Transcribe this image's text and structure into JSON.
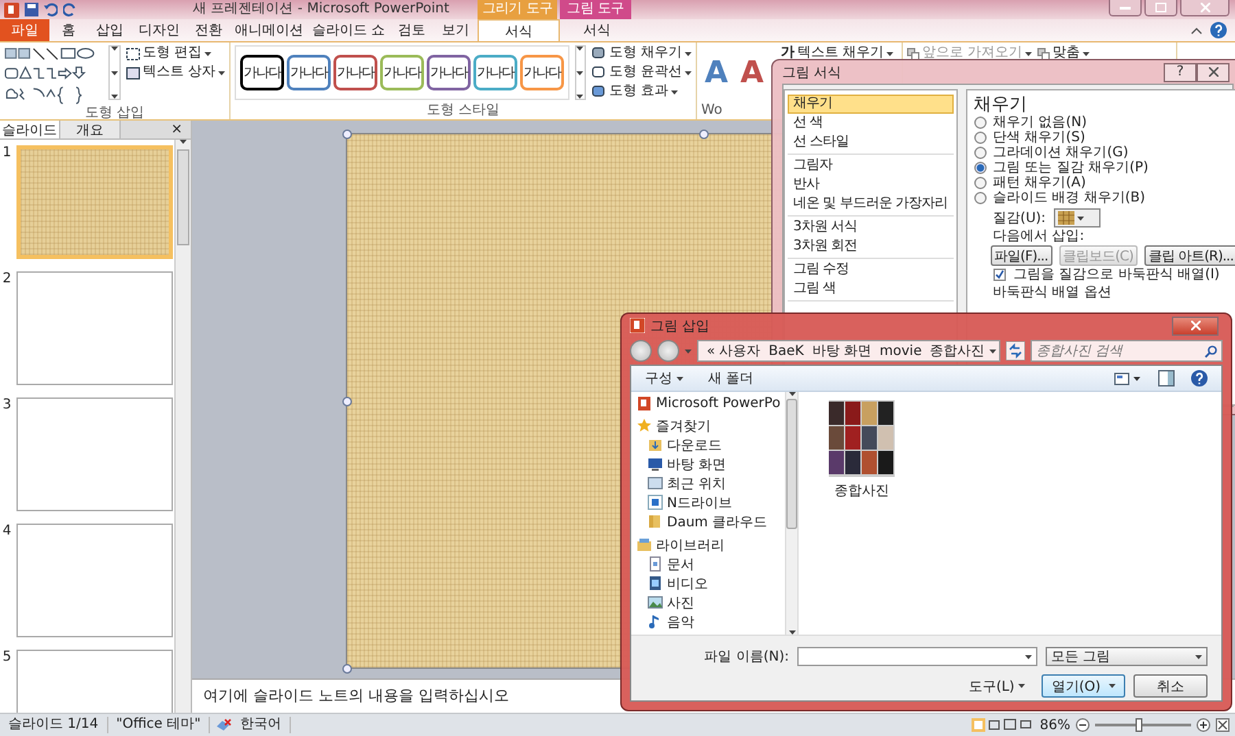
{
  "window": {
    "title": "새 프레젠테이션 - Microsoft PowerPoint",
    "context_tabs": [
      {
        "label": "그리기 도구",
        "color": "#e8a040"
      },
      {
        "label": "그림 도구",
        "color": "#d04a8a"
      }
    ]
  },
  "ribbon_tabs": [
    {
      "label": "파일",
      "kind": "file",
      "selected": false
    },
    {
      "label": "홈",
      "kind": "normal",
      "selected": false
    },
    {
      "label": "삽입",
      "kind": "normal",
      "selected": false
    },
    {
      "label": "디자인",
      "kind": "normal",
      "selected": false
    },
    {
      "label": "전환",
      "kind": "normal",
      "selected": false
    },
    {
      "label": "애니메이션",
      "kind": "normal",
      "selected": false
    },
    {
      "label": "슬라이드 쇼",
      "kind": "normal",
      "selected": false
    },
    {
      "label": "검토",
      "kind": "normal",
      "selected": false
    },
    {
      "label": "보기",
      "kind": "normal",
      "selected": false
    },
    {
      "label": "서식",
      "kind": "context",
      "selected": true
    },
    {
      "label": "서식",
      "kind": "context",
      "selected": false
    }
  ],
  "shape_insert": {
    "label": "도형 삽입",
    "commands": [
      "도형 편집",
      "텍스트 상자"
    ]
  },
  "shape_styles": {
    "label": "도형 스타일",
    "presets": [
      {
        "text": "가나다",
        "color": "#000000"
      },
      {
        "text": "가나다",
        "color": "#4f81bd"
      },
      {
        "text": "가나다",
        "color": "#c0504d"
      },
      {
        "text": "가나다",
        "color": "#9bbb59"
      },
      {
        "text": "가나다",
        "color": "#8064a2"
      },
      {
        "text": "가나다",
        "color": "#4bacc6"
      },
      {
        "text": "가나다",
        "color": "#f79646"
      }
    ],
    "commands": [
      "도형 채우기",
      "도형 윤곽선",
      "도형 효과"
    ]
  },
  "wordart": {
    "label": "Wo",
    "samples": [
      {
        "text": "A",
        "color": "#4f81bd"
      },
      {
        "text": "A",
        "color": "#c0504d"
      }
    ],
    "glyph": "가",
    "command": "텍스트 채우기"
  },
  "arrange": {
    "commands": [
      {
        "text": "앞으로 가져오기",
        "disabled": true
      },
      {
        "text": "맞춤",
        "disabled": false
      }
    ]
  },
  "slides_pane": {
    "tabs": [
      {
        "label": "슬라이드",
        "selected": true
      },
      {
        "label": "개요",
        "selected": false
      }
    ],
    "close": "×",
    "slides": [
      {
        "number": "1",
        "kind": "texture",
        "selected": true
      },
      {
        "number": "2",
        "kind": "blank",
        "selected": false
      },
      {
        "number": "3",
        "kind": "blank",
        "selected": false
      },
      {
        "number": "4",
        "kind": "blank",
        "selected": false
      },
      {
        "number": "5",
        "kind": "blank",
        "selected": false
      }
    ]
  },
  "slide": {
    "kind": "texture"
  },
  "notes": "여기에 슬라이드 노트의 내용을 입력하십시오",
  "status_bar": {
    "items": [
      "슬라이드 1/14",
      "\"Office 테마\"",
      "한국어"
    ],
    "zoom": "86%",
    "zoom_level": {
      "level": 0.45
    }
  },
  "format_dialog": {
    "title": "그림 서식",
    "help": "?",
    "categories": [
      [
        {
          "label": "채우기",
          "selected": true
        },
        {
          "label": "선 색",
          "selected": false
        },
        {
          "label": "선 스타일",
          "selected": false
        }
      ],
      [
        {
          "label": "그림자",
          "selected": false
        },
        {
          "label": "반사",
          "selected": false
        },
        {
          "label": "네온 및 부드러운 가장자리",
          "selected": false
        }
      ],
      [
        {
          "label": "3차원 서식",
          "selected": false
        },
        {
          "label": "3차원 회전",
          "selected": false
        }
      ],
      [
        {
          "label": "그림 수정",
          "selected": false
        },
        {
          "label": "그림 색",
          "selected": false
        }
      ]
    ],
    "heading": "채우기",
    "options": [
      {
        "label": "채우기 없음(N)",
        "selected": false
      },
      {
        "label": "단색 채우기(S)",
        "selected": false
      },
      {
        "label": "그라데이션 채우기(G)",
        "selected": false
      },
      {
        "label": "그림 또는 질감 채우기(P)",
        "selected": true
      },
      {
        "label": "패턴 채우기(A)",
        "selected": false
      },
      {
        "label": "슬라이드 배경 채우기(B)",
        "selected": false
      }
    ],
    "texture_label": "질감(U):",
    "insert_from": "다음에서 삽입:",
    "buttons": [
      {
        "label": "파일(F)...",
        "disabled": false
      },
      {
        "label": "클립보드(C)",
        "disabled": true
      },
      {
        "label": "클립 아트(R)...",
        "disabled": false
      }
    ],
    "tile": {
      "label": "그림을 질감으로 바둑판식 배열(I)",
      "checked": true
    },
    "tile_options": "바둑판식 배열 옵션"
  },
  "insert_dialog": {
    "title": "그림 삽입",
    "path_prefix": "«",
    "path": [
      "사용자",
      "BaeK",
      "바탕 화면",
      "movie",
      "종합사진"
    ],
    "search_placeholder": "종합사진 검색",
    "toolbar": [
      "구성",
      "새 폴더"
    ],
    "nav": [
      {
        "label": "Microsoft PowerPo",
        "kind": "app"
      },
      {
        "label": "즐겨찾기",
        "kind": "star",
        "children": [
          {
            "label": "다운로드",
            "kind": "download"
          },
          {
            "label": "바탕 화면",
            "kind": "desktop"
          },
          {
            "label": "최근 위치",
            "kind": "recent"
          },
          {
            "label": "N드라이브",
            "kind": "ndrive"
          },
          {
            "label": "Daum 클라우드",
            "kind": "folder"
          }
        ]
      },
      {
        "label": "라이브러리",
        "kind": "library",
        "children": [
          {
            "label": "문서",
            "kind": "document"
          },
          {
            "label": "비디오",
            "kind": "video"
          },
          {
            "label": "사진"
          },
          {
            "label": "음악",
            "kind": "music"
          }
        ]
      }
    ],
    "files": [
      {
        "name": "종합사진",
        "kind": "picture"
      }
    ],
    "filename_label": "파일 이름(N):",
    "filetype": "모든 그림",
    "tools": "도구(L)",
    "open": "열기(O)",
    "cancel": "취소"
  }
}
